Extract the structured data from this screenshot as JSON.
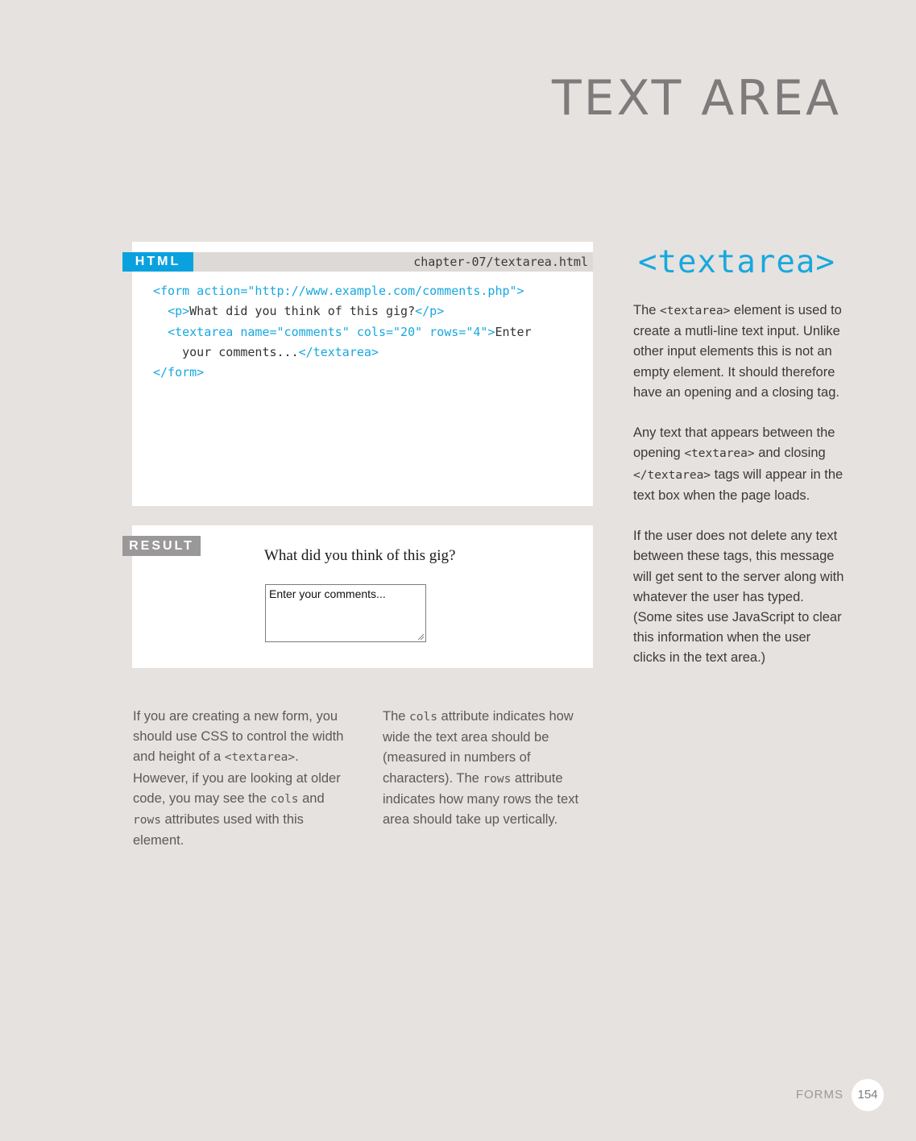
{
  "page": {
    "title": "TEXT AREA",
    "section": "FORMS",
    "page_number": "154"
  },
  "code_example": {
    "label": "HTML",
    "filename": "chapter-07/textarea.html",
    "lines": [
      [
        {
          "t": "tag",
          "v": "<form action=\"http://www.example.com/comments.php\">"
        }
      ],
      [
        {
          "t": "text",
          "v": "  "
        },
        {
          "t": "tag",
          "v": "<p>"
        },
        {
          "t": "text",
          "v": "What did you think of this gig?"
        },
        {
          "t": "tag",
          "v": "</p>"
        }
      ],
      [
        {
          "t": "text",
          "v": "  "
        },
        {
          "t": "tag",
          "v": "<textarea name=\"comments\" cols=\"20\" rows=\"4\">"
        },
        {
          "t": "text",
          "v": "Enter"
        }
      ],
      [
        {
          "t": "text",
          "v": "    your comments..."
        },
        {
          "t": "tag",
          "v": "</textarea>"
        }
      ],
      [
        {
          "t": "tag",
          "v": "</form>"
        }
      ]
    ]
  },
  "result": {
    "label": "RESULT",
    "question": "What did you think of this gig?",
    "textarea_value": "Enter your comments..."
  },
  "sidebar": {
    "heading": "<textarea>",
    "p1": [
      {
        "t": "text",
        "v": "The "
      },
      {
        "t": "code",
        "v": "<textarea>"
      },
      {
        "t": "text",
        "v": " element is used to create a mutli-line text input. Unlike other input elements this is not an empty element. It should therefore have an opening and a closing tag."
      }
    ],
    "p2": [
      {
        "t": "text",
        "v": "Any text that appears between the opening "
      },
      {
        "t": "code",
        "v": "<textarea>"
      },
      {
        "t": "text",
        "v": " and closing "
      },
      {
        "t": "code",
        "v": "</textarea>"
      },
      {
        "t": "text",
        "v": " tags will appear in the text box when the page loads."
      }
    ],
    "p3": [
      {
        "t": "text",
        "v": "If the user does not delete any text between these tags, this message will get sent to the server along with whatever the user has typed. (Some sites use JavaScript to clear this information when the user clicks in the text area.)"
      }
    ]
  },
  "bottom": {
    "col1": [
      {
        "t": "text",
        "v": "If you are creating a new form, you should use CSS to control the width and height of a "
      },
      {
        "t": "code",
        "v": "<textarea>"
      },
      {
        "t": "text",
        "v": ". However, if you are looking at older code, you may see the "
      },
      {
        "t": "code",
        "v": "cols"
      },
      {
        "t": "text",
        "v": " and "
      },
      {
        "t": "code",
        "v": "rows"
      },
      {
        "t": "text",
        "v": " attributes used with this element."
      }
    ],
    "col2": [
      {
        "t": "text",
        "v": "The "
      },
      {
        "t": "code",
        "v": "cols"
      },
      {
        "t": "text",
        "v": " attribute indicates how wide the text area should be (measured in numbers of characters). The "
      },
      {
        "t": "code",
        "v": "rows"
      },
      {
        "t": "text",
        "v": " attribute indicates how many rows the text area should take up vertically."
      }
    ]
  },
  "colors": {
    "accent": "#17a8df",
    "background": "#e6e2df",
    "title": "#7d7b7b"
  }
}
